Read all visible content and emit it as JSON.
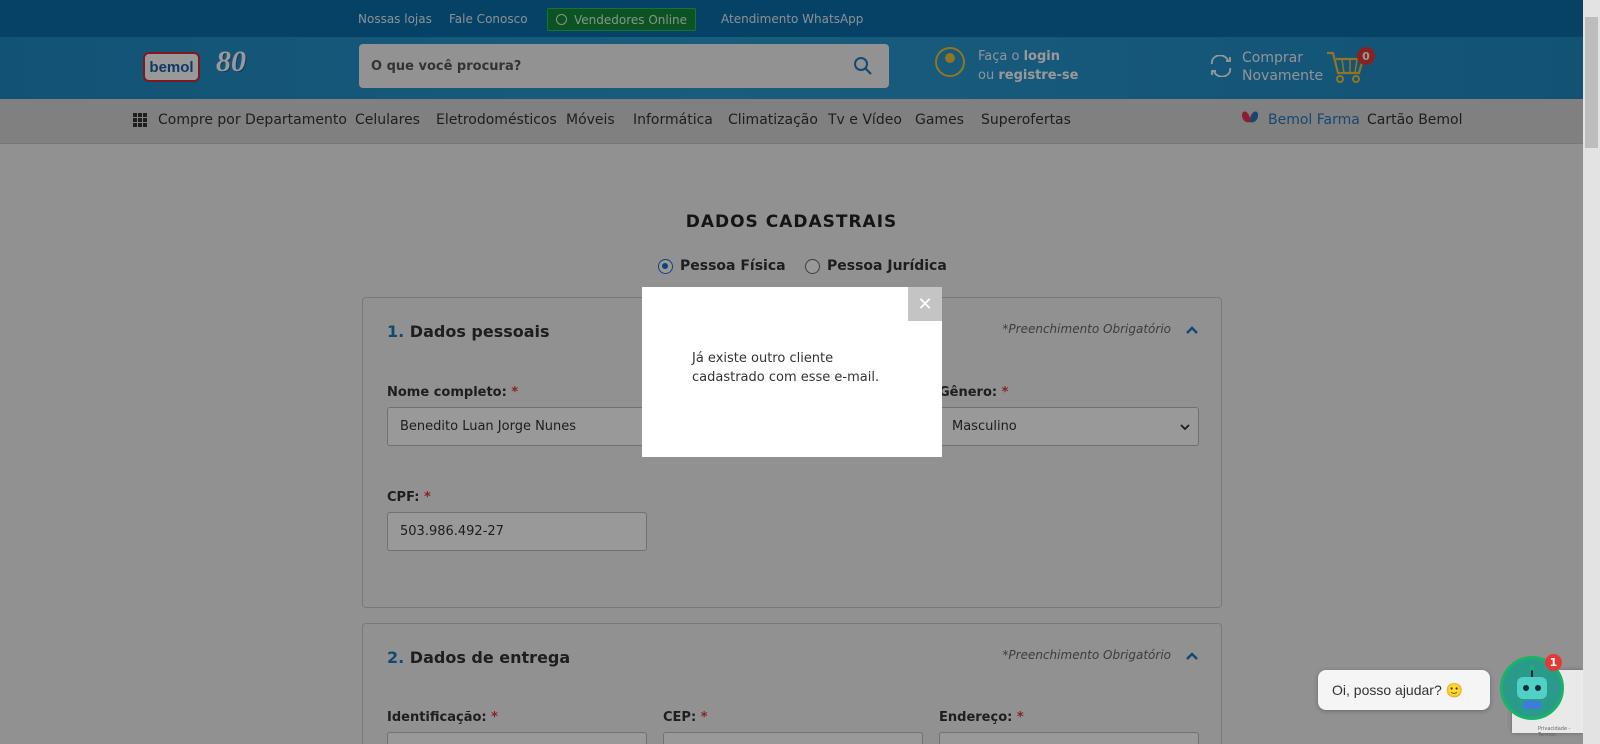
{
  "topbar": {
    "links": [
      "Nossas lojas",
      "Fale Conosco"
    ],
    "vendors_button": "Vendedores Online",
    "whatsapp_link": "Atendimento WhatsApp"
  },
  "header": {
    "logo_text": "bemol",
    "anniversary": "80",
    "search_placeholder": "O que você procura?",
    "login_prefix": "Faça o",
    "login_word": "login",
    "register_prefix": "ou",
    "register_word": "registre-se",
    "reorder_line1": "Comprar",
    "reorder_line2": "Novamente",
    "cart_count": "0"
  },
  "nav": {
    "department": "Compre por Departamento",
    "items": [
      "Celulares",
      "Eletrodomésticos",
      "Móveis",
      "Informática",
      "Climatização",
      "Tv e Vídeo",
      "Games",
      "Superofertas"
    ],
    "farma": "Bemol Farma",
    "card": "Cartão Bemol"
  },
  "form": {
    "title": "DADOS CADASTRAIS",
    "person_type": [
      "Pessoa Física",
      "Pessoa Jurídica"
    ],
    "selected_person_type": "Pessoa Física",
    "section1": {
      "number": "1.",
      "title": "Dados pessoais",
      "required_note": "*Preenchimento Obrigatório",
      "name_label": "Nome completo:",
      "name_value": "Benedito Luan Jorge Nunes",
      "gender_label": "Gênero:",
      "gender_value": "Masculino",
      "cpf_label": "CPF:",
      "cpf_value": "503.986.492-27",
      "asterisk": "*"
    },
    "section2": {
      "number": "2.",
      "title": "Dados de entrega",
      "required_note": "*Preenchimento Obrigatório",
      "id_label": "Identificação:",
      "cep_label": "CEP:",
      "address_label": "Endereço:"
    }
  },
  "modal": {
    "message": "Já existe outro cliente cadastrado com esse e-mail.",
    "close_glyph": "✕"
  },
  "chat": {
    "greeting": "Oi, posso ajudar? 🙂",
    "badge": "1",
    "recaptcha_text": "Privacidade - Termos"
  },
  "colors": {
    "topbar": "#0a6fa8",
    "header": "#2a9ad0",
    "accent_blue": "#1f7ac0",
    "required_red": "#e53935",
    "vendors_green": "#138a3a"
  }
}
